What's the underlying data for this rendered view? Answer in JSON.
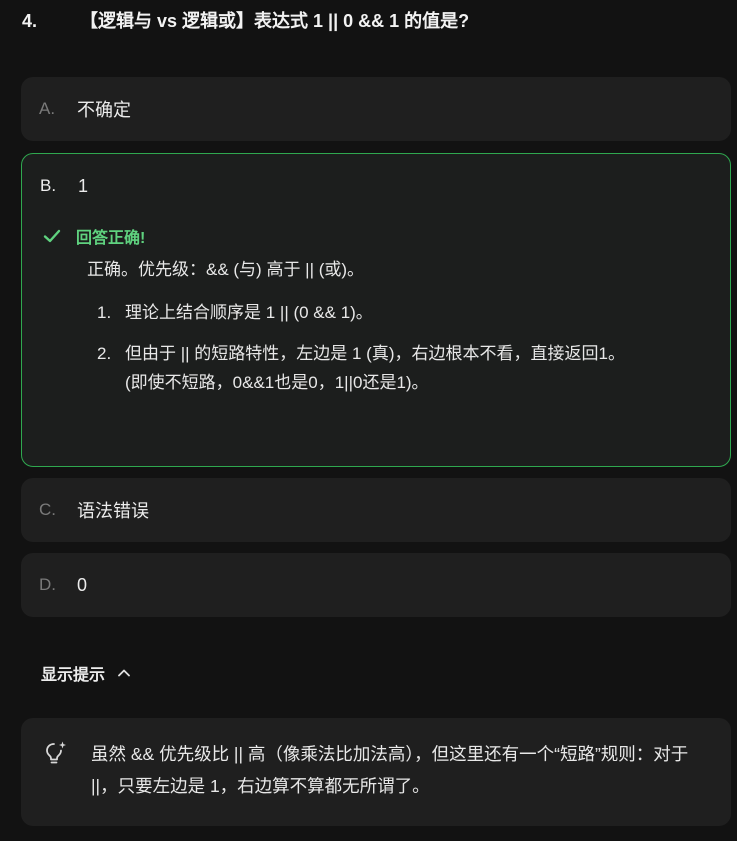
{
  "question": {
    "number": "4.",
    "text": "【逻辑与 vs 逻辑或】表达式 1 || 0 && 1 的值是?"
  },
  "options": [
    {
      "letter": "A.",
      "text": "不确定"
    },
    {
      "letter": "B.",
      "text": "1"
    },
    {
      "letter": "C.",
      "text": "语法错误"
    },
    {
      "letter": "D.",
      "text": "0"
    }
  ],
  "feedback": {
    "title": "回答正确!",
    "summary": "正确。优先级：&& (与) 高于 || (或)。",
    "points": [
      {
        "index": "1.",
        "text": "理论上结合顺序是 1 || (0 && 1)。"
      },
      {
        "index": "2.",
        "text": "但由于 || 的短路特性，左边是 1 (真)，右边根本不看，直接返回1。",
        "extra": "(即使不短路，0&&1也是0，1||0还是1)。"
      }
    ]
  },
  "hint": {
    "toggle_label": "显示提示",
    "text": "虽然 && 优先级比 || 高（像乘法比加法高），但这里还有一个“短路”规则：对于 ||，只要左边是 1，右边算不算都无所谓了。"
  },
  "colors": {
    "correct": "#2fa84f",
    "correct_text": "#5fd27f",
    "background": "#121212",
    "card": "#1f1f1f"
  },
  "icons": {
    "correct": "check-icon",
    "hint": "lightbulb-icon",
    "toggle": "chevron-up-icon"
  }
}
